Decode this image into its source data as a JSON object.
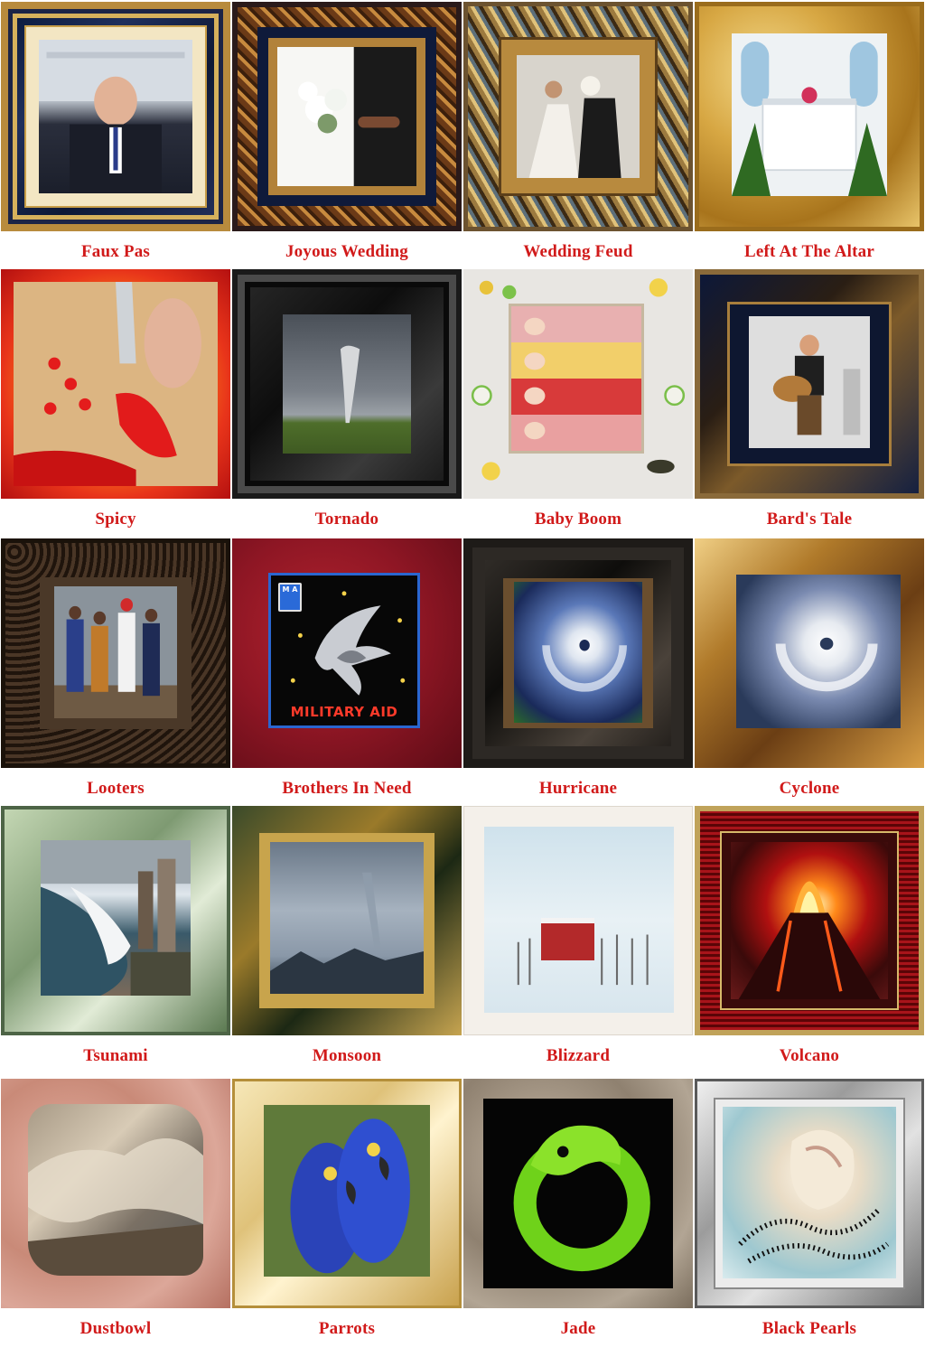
{
  "tiles": [
    {
      "caption": "Faux Pas",
      "frame": "navy-gold",
      "picture": "press-conference-photo",
      "embedded_text": "THE WHITE HOUSE WASHINGTON"
    },
    {
      "caption": "Joyous Wedding",
      "frame": "ornate-bronze",
      "picture": "bridal-bouquet-photo"
    },
    {
      "caption": "Wedding Feud",
      "frame": "ornate-silver-gold",
      "picture": "wedding-cake-fight-photo"
    },
    {
      "caption": "Left At The Altar",
      "frame": "gold",
      "picture": "empty-altar-photo"
    },
    {
      "caption": "Spicy",
      "frame": "fire",
      "picture": "sliced-chili-pepper-photo"
    },
    {
      "caption": "Tornado",
      "frame": "black",
      "picture": "tornado-photo"
    },
    {
      "caption": "Baby Boom",
      "frame": "quilled-paper",
      "picture": "newborn-babies-photo"
    },
    {
      "caption": "Bard's Tale",
      "frame": "navy-bronze",
      "picture": "guitar-bard-photo"
    },
    {
      "caption": "Looters",
      "frame": "dark-weave",
      "picture": "looters-flood-photo"
    },
    {
      "caption": "Brothers In Need",
      "frame": "crimson",
      "picture": "military-aid-eagle-emblem",
      "embedded_text": "MILITARY AID",
      "badge_text": "M A"
    },
    {
      "caption": "Hurricane",
      "frame": "dark-wood",
      "picture": "hurricane-satellite-photo"
    },
    {
      "caption": "Cyclone",
      "frame": "light-wood",
      "picture": "cyclone-satellite-photo"
    },
    {
      "caption": "Tsunami",
      "frame": "sage",
      "picture": "tsunami-wave-city-photo"
    },
    {
      "caption": "Monsoon",
      "frame": "green-gold",
      "picture": "monsoon-rain-clouds-photo"
    },
    {
      "caption": "Blizzard",
      "frame": "photo-paper",
      "picture": "snowy-red-barn-photo"
    },
    {
      "caption": "Volcano",
      "frame": "red-bevel",
      "picture": "erupting-volcano-photo"
    },
    {
      "caption": "Dustbowl",
      "frame": "rose-stone-cutout",
      "picture": "dust-storm-aerial-photo"
    },
    {
      "caption": "Parrots",
      "frame": "pale-gold",
      "picture": "blue-macaws-photo"
    },
    {
      "caption": "Jade",
      "frame": "stone",
      "picture": "jade-carving-photo"
    },
    {
      "caption": "Black Pearls",
      "frame": "silver-ornate",
      "picture": "seashell-black-pearls-photo"
    }
  ],
  "colors": {
    "caption": "#d11a1a",
    "background": "#ffffff"
  }
}
